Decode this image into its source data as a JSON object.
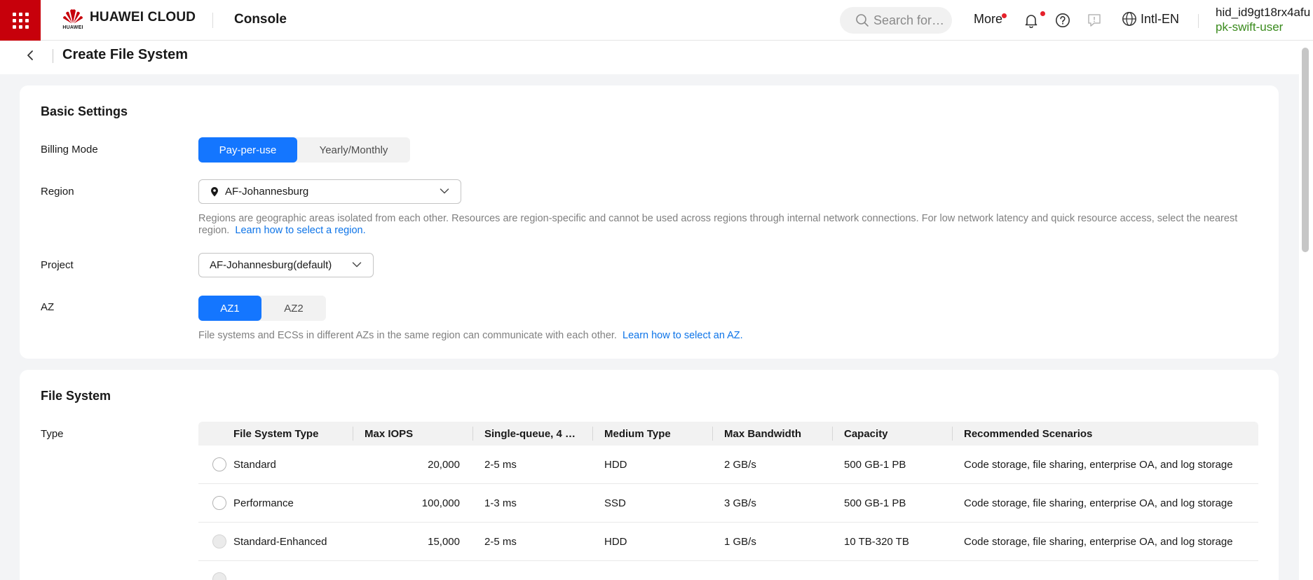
{
  "header": {
    "brand": "HUAWEI CLOUD",
    "brand_small": "HUAWEI",
    "console_label": "Console",
    "search_placeholder": "Search for…",
    "more_label": "More",
    "language_label": "Intl-EN",
    "user_id": "hid_id9gt18rx4afu",
    "user_name": "pk-swift-user",
    "brand_color": "#c7000b"
  },
  "page": {
    "title": "Create File System"
  },
  "basic_settings": {
    "title": "Basic Settings",
    "billing_mode": {
      "label": "Billing Mode",
      "options": [
        "Pay-per-use",
        "Yearly/Monthly"
      ],
      "selected": "Pay-per-use"
    },
    "region": {
      "label": "Region",
      "value": "AF-Johannesburg",
      "hint": "Regions are geographic areas isolated from each other. Resources are region-specific and cannot be used across regions through internal network connections. For low network latency and quick resource access, select the nearest region.",
      "link": "Learn how to select a region."
    },
    "project": {
      "label": "Project",
      "value": "AF-Johannesburg(default)"
    },
    "az": {
      "label": "AZ",
      "options": [
        "AZ1",
        "AZ2"
      ],
      "selected": "AZ1",
      "hint": "File systems and ECSs in different AZs in the same region can communicate with each other.",
      "link": "Learn how to select an AZ."
    }
  },
  "file_system": {
    "title": "File System",
    "type_label": "Type",
    "columns": [
      "File System Type",
      "Max IOPS",
      "Single-queue, 4 …",
      "Medium Type",
      "Max Bandwidth",
      "Capacity",
      "Recommended Scenarios"
    ],
    "rows": [
      {
        "type": "Standard",
        "iops": "20,000",
        "latency": "2-5 ms",
        "medium": "HDD",
        "bandwidth": "2 GB/s",
        "capacity": "500 GB-1 PB",
        "scenarios": "Code storage, file sharing, enterprise OA, and log storage",
        "disabled": false
      },
      {
        "type": "Performance",
        "iops": "100,000",
        "latency": "1-3 ms",
        "medium": "SSD",
        "bandwidth": "3 GB/s",
        "capacity": "500 GB-1 PB",
        "scenarios": "Code storage, file sharing, enterprise OA, and log storage",
        "disabled": false
      },
      {
        "type": "Standard-Enhanced",
        "iops": "15,000",
        "latency": "2-5 ms",
        "medium": "HDD",
        "bandwidth": "1 GB/s",
        "capacity": "10 TB-320 TB",
        "scenarios": "Code storage, file sharing, enterprise OA, and log storage",
        "disabled": true
      }
    ]
  },
  "colors": {
    "accent": "#1476ff",
    "link": "#0d74e8",
    "user_name": "#3a8b1d",
    "notification_dot": "#e5212b"
  }
}
